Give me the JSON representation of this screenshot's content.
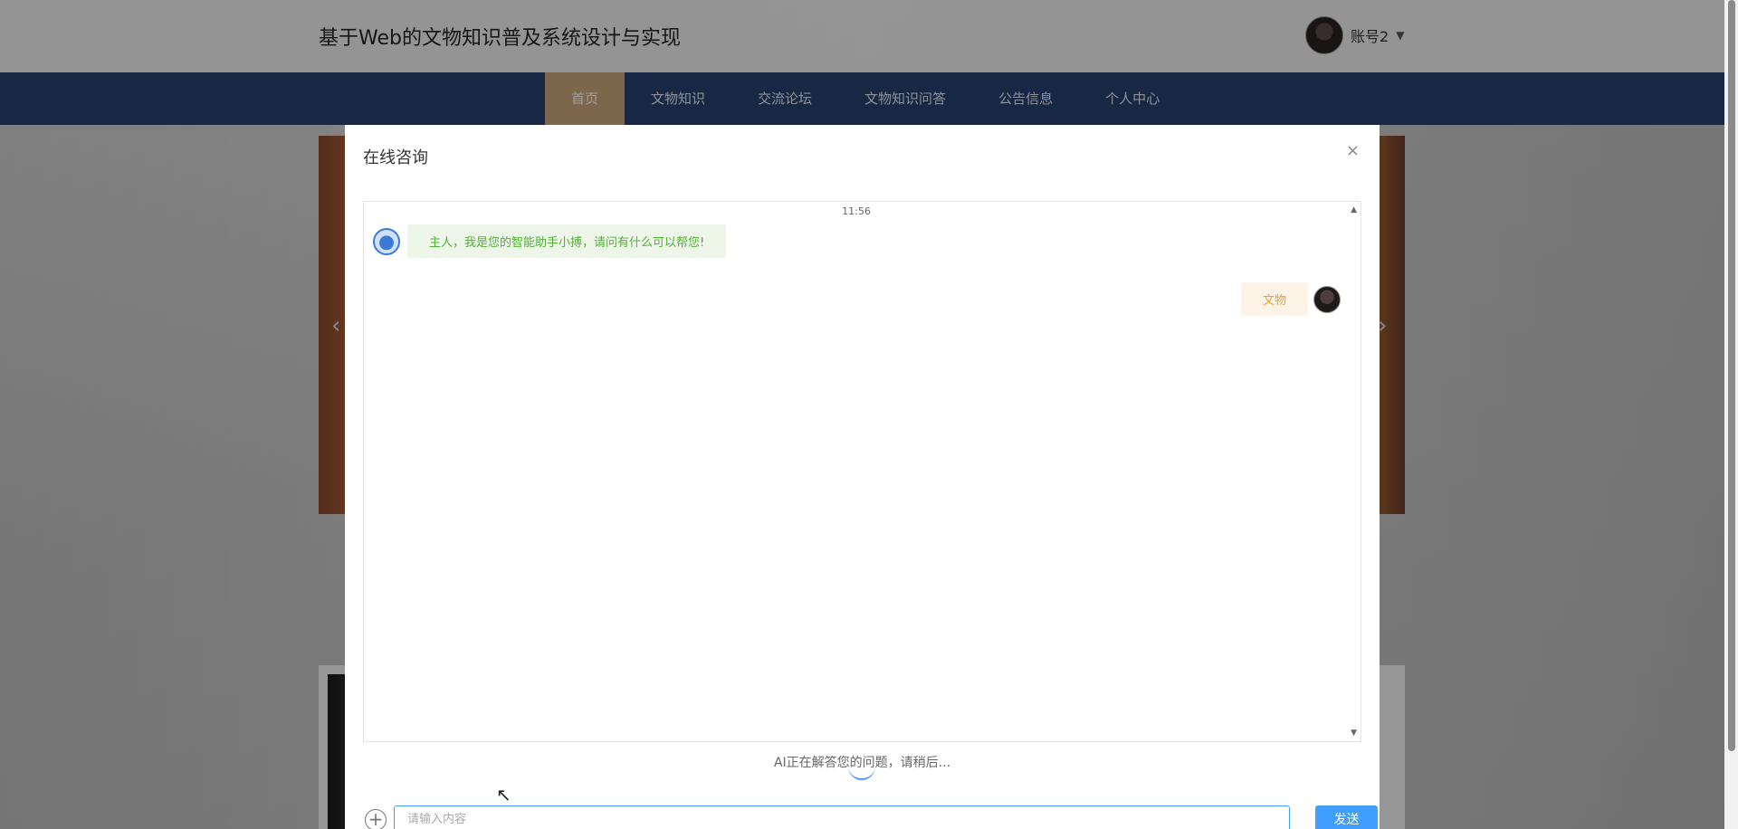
{
  "site": {
    "title": "基于Web的文物知识普及系统设计与实现",
    "account_name": "账号2",
    "account_caret": "▼"
  },
  "nav": {
    "items": [
      {
        "label": "首页",
        "active": true
      },
      {
        "label": "文物知识",
        "active": false
      },
      {
        "label": "交流论坛",
        "active": false
      },
      {
        "label": "文物知识问答",
        "active": false
      },
      {
        "label": "公告信息",
        "active": false
      },
      {
        "label": "个人中心",
        "active": false
      }
    ]
  },
  "banner": {
    "prev_icon": "‹",
    "next_icon": "›"
  },
  "dialog": {
    "title": "在线咨询",
    "close_icon": "×",
    "chat": {
      "time": "11:56",
      "messages": [
        {
          "from": "bot",
          "text": "主人，我是您的智能助手小搏，请问有什么可以帮您!"
        },
        {
          "from": "user",
          "text": "文物"
        }
      ],
      "scroll_up": "▲",
      "scroll_down": "▼"
    },
    "loading_text": "AI正在解答您的问题，请稍后...",
    "input": {
      "placeholder": "请输入内容",
      "value": ""
    },
    "add_icon": "+",
    "send_label": "发送"
  },
  "colors": {
    "nav_bg": "#27406e",
    "nav_active": "#c9a77b",
    "primary": "#409eff",
    "bot_text": "#52b035",
    "user_text": "#e6a23c"
  }
}
